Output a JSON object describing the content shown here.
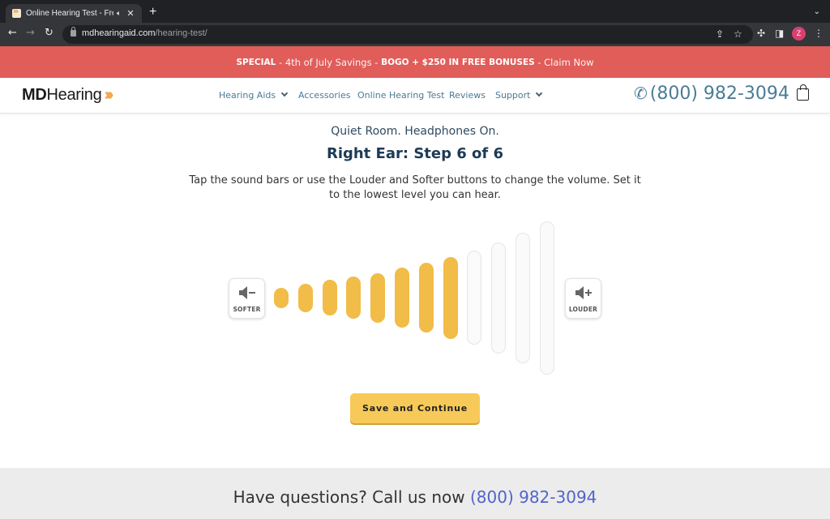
{
  "browser": {
    "tab_title": "Online Hearing Test - Free, Quick & Accurate",
    "url_domain": "mdhearingaid.com",
    "url_path": "/hearing-test/",
    "profile_initial": "Z"
  },
  "promo": {
    "special": "SPECIAL",
    "sep1": " - ",
    "savings": "4th of July Savings",
    "sep2": " - ",
    "offer": "BOGO + $250 IN FREE BONUSES",
    "sep3": " - ",
    "cta": "Claim Now"
  },
  "header": {
    "logo_bold": "MD",
    "logo_rest": "Hearing",
    "nav": [
      {
        "label": "Hearing Aids",
        "dropdown": true
      },
      {
        "label": "Accessories",
        "dropdown": false
      },
      {
        "label": "Online Hearing Test",
        "dropdown": false
      },
      {
        "label": "Reviews",
        "dropdown": false
      },
      {
        "label": "Support",
        "dropdown": true
      }
    ],
    "phone": "(800) 982-3094"
  },
  "test": {
    "subtitle": "Quiet Room. Headphones On.",
    "title": "Right Ear: Step 6 of 6",
    "instructions": "Tap the sound bars or use the Louder and Softer buttons to change the volume. Set it to the lowest level you can hear.",
    "softer_label": "SOFTER",
    "louder_label": "LOUDER",
    "volume_level": 8,
    "volume_levels_total": 12,
    "save_label": "Save and Continue"
  },
  "footer": {
    "text": "Have questions? Call us now ",
    "phone": "(800) 982-3094"
  },
  "colors": {
    "promo_bg": "#e05d59",
    "nav_text": "#4a7a96",
    "bar_on": "#f1bc47",
    "button": "#f7c958",
    "footer_link": "#5265c8"
  }
}
